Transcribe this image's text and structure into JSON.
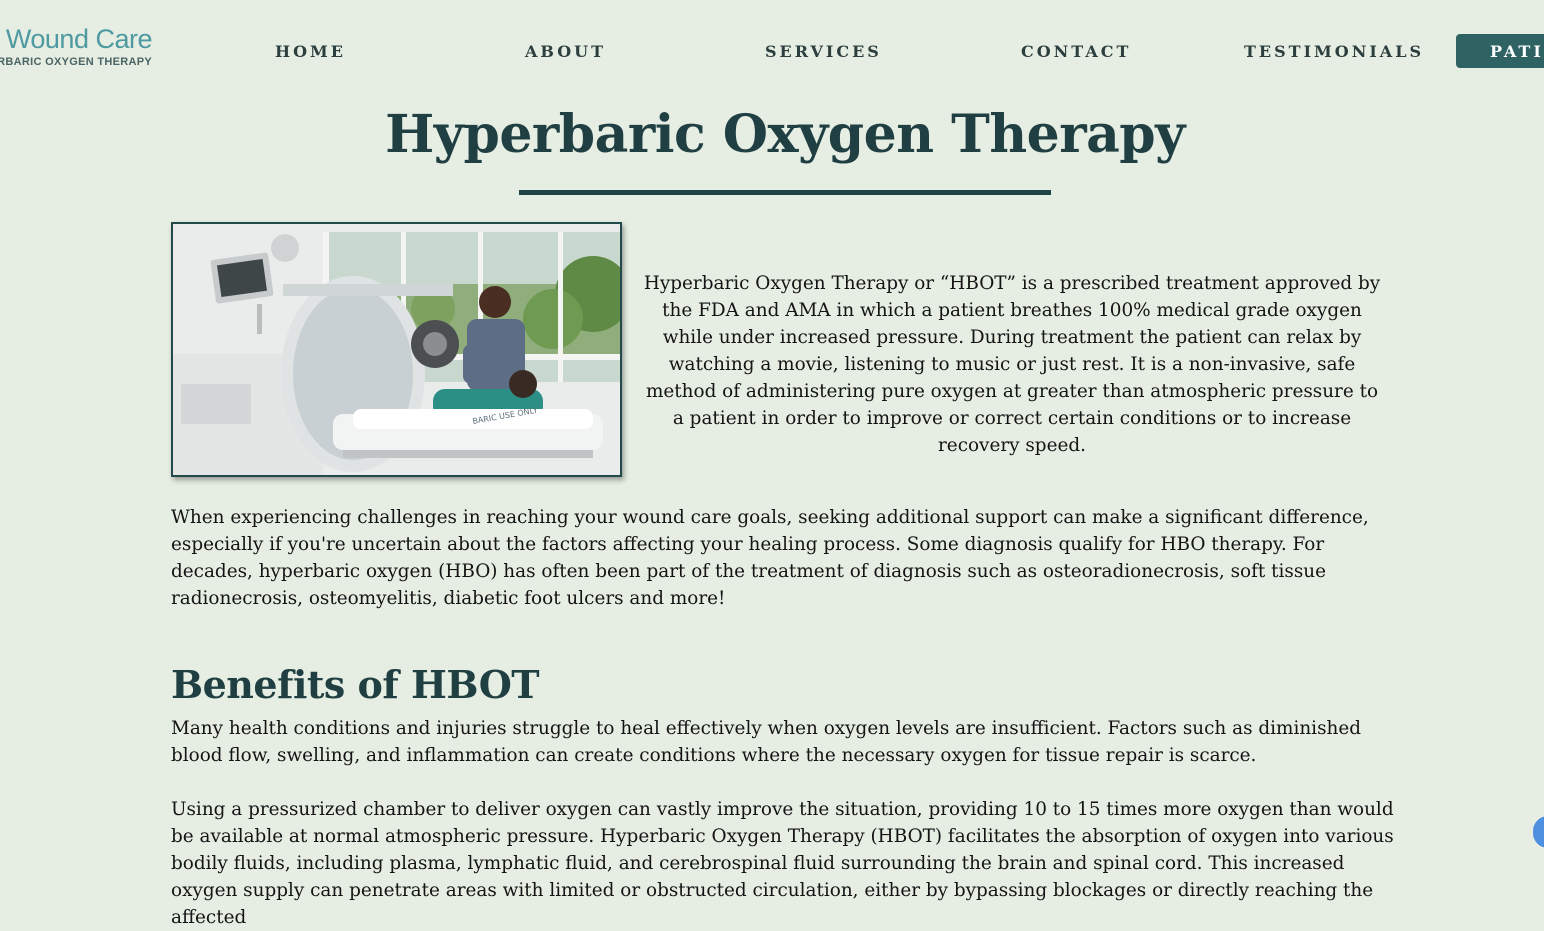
{
  "header": {
    "logo": {
      "title": "e Wound Care",
      "subtitle": "RBARIC OXYGEN THERAPY"
    },
    "nav": [
      "HOME",
      "ABOUT",
      "SERVICES",
      "CONTACT",
      "TESTIMONIALS"
    ],
    "cta_label": "PATI"
  },
  "main": {
    "title": "Hyperbaric Oxygen Therapy",
    "intro": "Hyperbaric Oxygen Therapy or “HBOT” is a prescribed treatment approved by the FDA and AMA in which a patient breathes 100% medical grade oxygen while under increased pressure. During treatment the patient can relax by watching a movie, listening to music or just rest. It is a non-invasive, safe method of administering pure oxygen at greater than atmospheric pressure to a patient in order to improve or correct certain conditions or to increase recovery speed.",
    "paragraph1": "When experiencing challenges in reaching your wound care goals, seeking additional support can make a significant difference, especially if you're uncertain about the factors affecting your healing process. Some diagnosis qualify for HBO therapy. For decades, hyperbaric oxygen (HBO) has often been part of the treatment of diagnosis such as osteoradionecrosis, soft tissue radionecrosis, osteomyelitis, diabetic foot ulcers and more!",
    "benefits_heading": "Benefits of HBOT",
    "benefits_p1": "Many health conditions and injuries struggle to heal effectively when oxygen levels are insufficient. Factors such as diminished blood flow, swelling, and inflammation can create conditions where the necessary oxygen for tissue repair is scarce.",
    "benefits_p2": "Using a pressurized chamber to deliver oxygen can vastly improve the situation, providing 10 to 15 times more oxygen than would be available at normal atmospheric pressure. Hyperbaric Oxygen Therapy (HBOT) facilitates the absorption of oxygen into various bodily fluids, including plasma, lymphatic fluid, and cerebrospinal fluid surrounding the brain and spinal cord. This increased oxygen supply can penetrate areas with limited or obstructed circulation, either by bypassing blockages or directly reaching the affected",
    "photo_caption_text": "BARIC USE ONLY"
  },
  "colors": {
    "background": "#e6ede3",
    "heading": "#1f3f42",
    "accent": "#2f6363",
    "logo": "#4e9aa0"
  }
}
